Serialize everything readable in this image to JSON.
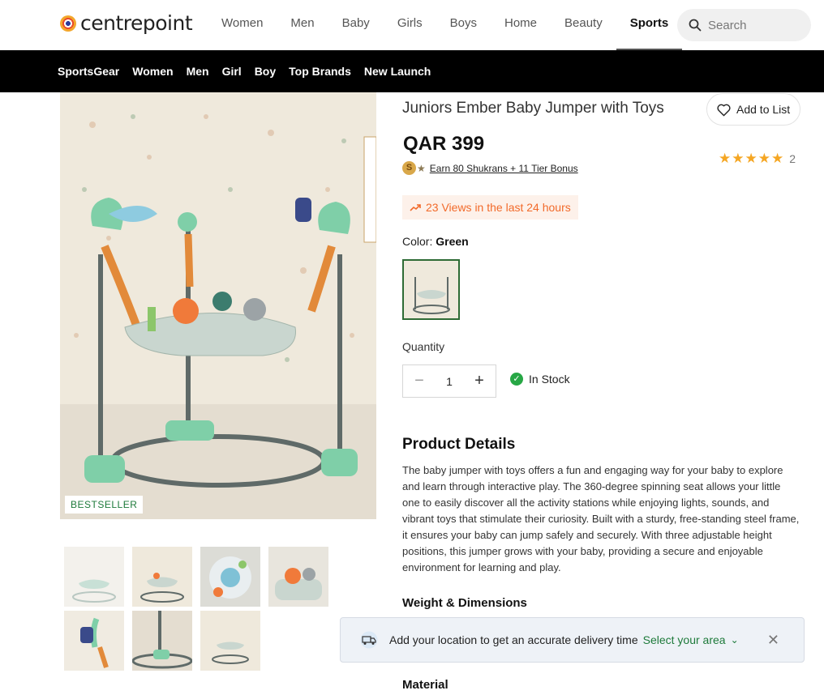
{
  "brand": {
    "name": "centrepoint"
  },
  "main_nav": [
    {
      "label": "Women"
    },
    {
      "label": "Men"
    },
    {
      "label": "Baby"
    },
    {
      "label": "Girls"
    },
    {
      "label": "Boys"
    },
    {
      "label": "Home"
    },
    {
      "label": "Beauty"
    },
    {
      "label": "Sports",
      "active": true
    }
  ],
  "search": {
    "placeholder": "Search"
  },
  "sub_nav": [
    {
      "label": "SportsGear"
    },
    {
      "label": "Women"
    },
    {
      "label": "Men"
    },
    {
      "label": "Girl"
    },
    {
      "label": "Boy"
    },
    {
      "label": "Top Brands"
    },
    {
      "label": "New Launch"
    }
  ],
  "product": {
    "title": "Juniors Ember Baby Jumper with Toys",
    "wishlist_label": "Add to List",
    "price": "QAR 399",
    "rating_stars": "★★★★★",
    "rating_count": "2",
    "shukrans_text": "Earn 80 Shukrans + 11  Tier Bonus",
    "views_text": "23 Views in the last 24 hours",
    "color_label": "Color:",
    "color_value": "Green",
    "badge": "BESTSELLER",
    "quantity_label": "Quantity",
    "quantity_value": "1",
    "stock_status": "In Stock",
    "details_heading": "Product Details",
    "description": "The baby jumper with toys offers a fun and engaging way for your baby to explore and learn through interactive play. The 360-degree spinning seat allows your little one to easily discover all the activity stations while enjoying lights, sounds, and vibrant toys that stimulate their curiosity. Built with a sturdy, free-standing steel frame, it ensures your baby can jump safely and securely. With three adjustable height positions, this jumper grows with your baby, providing a secure and enjoyable environment for learning and play.",
    "weight_heading": "Weight & Dimensions",
    "material_heading": "Material"
  },
  "delivery_toast": {
    "text": "Add your location to get an accurate delivery time",
    "action": "Select your area"
  },
  "colors": {
    "accent_green": "#1d7a3a",
    "views_orange": "#f26a2a",
    "star_yellow": "#f5a623",
    "nav_black": "#000000"
  }
}
